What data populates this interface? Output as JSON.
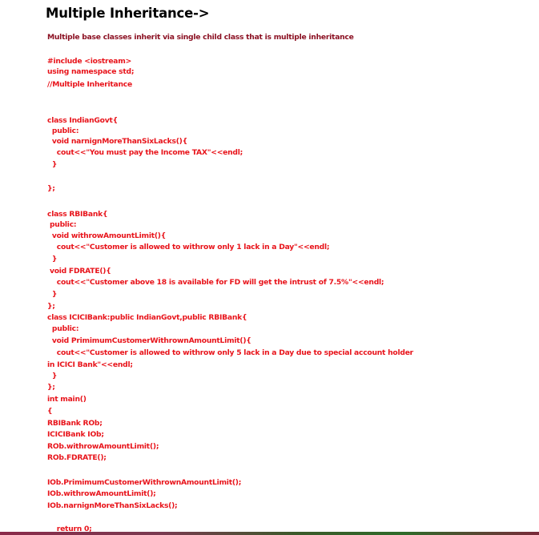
{
  "title": "Multiple Inheritance->",
  "description": "Multiple base classes inherit via single child class that is multiple inheritance",
  "colors": {
    "code": "#e8141b",
    "description": "#8b1022",
    "title": "#000000"
  },
  "code_lines": [
    "#include <iostream>",
    "using namespace std;",
    "//Multiple Inheritance",
    "class IndianGovt{",
    "  public:",
    "  void narnignMoreThanSixLacks(){",
    "    cout<<\"You must pay the Income TAX\"<<endl;",
    "  }",
    "};",
    "class RBIBank{",
    " public:",
    "  void withrowAmountLimit(){",
    "    cout<<\"Customer is allowed to withrow only 1 lack in a Day\"<<endl;",
    "  }",
    " void FDRATE(){",
    "    cout<<\"Customer above 18 is available for FD will get the intrust of 7.5%\"<<endl;",
    "  }",
    "};",
    "class ICICIBank:public IndianGovt,public RBIBank{",
    "  public:",
    "  void PrimimumCustomerWithrownAmountLimit(){",
    "    cout<<\"Customer is allowed to withrow only 5 lack in a Day due to special account holder",
    "in ICICI Bank\"<<endl;",
    "  }",
    "};",
    "int main()",
    "{",
    "RBIBank ROb;",
    "ICICIBank IOb;",
    "ROb.withrowAmountLimit();",
    "ROb.FDRATE();",
    "IOb.PrimimumCustomerWithrownAmountLimit();",
    "IOb.withrowAmountLimit();",
    "IOb.narnignMoreThanSixLacks();",
    "    return 0;"
  ]
}
